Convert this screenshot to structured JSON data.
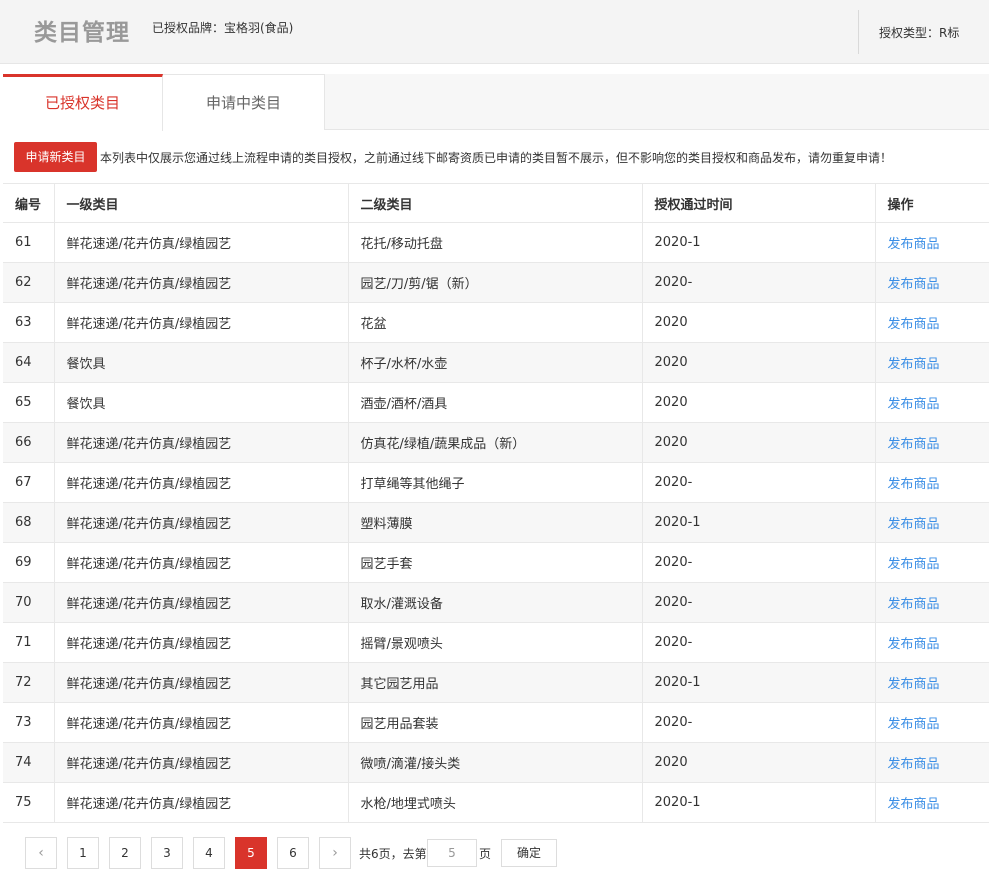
{
  "header": {
    "title": "类目管理",
    "brand": "已授权品牌：宝格羽(食品)",
    "auth_type": "授权类型：R标"
  },
  "tabs": [
    {
      "label": "已授权类目",
      "active": true
    },
    {
      "label": "申请中类目",
      "active": false
    }
  ],
  "notice": {
    "apply_button": "申请新类目",
    "message": "本列表中仅展示您通过线上流程申请的类目授权，之前通过线下邮寄资质已申请的类目暂不展示，但不影响您的类目授权和商品发布，请勿重复申请！"
  },
  "table": {
    "columns": [
      "编号",
      "一级类目",
      "二级类目",
      "授权通过时间",
      "操作"
    ],
    "rows": [
      {
        "id": "61",
        "cat1": "鲜花速递/花卉仿真/绿植园艺",
        "cat2": "花托/移动托盘",
        "time": "2020-1",
        "action": "发布商品"
      },
      {
        "id": "62",
        "cat1": "鲜花速递/花卉仿真/绿植园艺",
        "cat2": "园艺/刀/剪/锯（新）",
        "time": "2020-",
        "action": "发布商品"
      },
      {
        "id": "63",
        "cat1": "鲜花速递/花卉仿真/绿植园艺",
        "cat2": "花盆",
        "time": "2020",
        "action": "发布商品"
      },
      {
        "id": "64",
        "cat1": "餐饮具",
        "cat2": "杯子/水杯/水壶",
        "time": "2020",
        "action": "发布商品"
      },
      {
        "id": "65",
        "cat1": "餐饮具",
        "cat2": "酒壶/酒杯/酒具",
        "time": "2020",
        "action": "发布商品"
      },
      {
        "id": "66",
        "cat1": "鲜花速递/花卉仿真/绿植园艺",
        "cat2": "仿真花/绿植/蔬果成品（新）",
        "time": "2020",
        "action": "发布商品"
      },
      {
        "id": "67",
        "cat1": "鲜花速递/花卉仿真/绿植园艺",
        "cat2": "打草绳等其他绳子",
        "time": "2020-",
        "action": "发布商品"
      },
      {
        "id": "68",
        "cat1": "鲜花速递/花卉仿真/绿植园艺",
        "cat2": "塑料薄膜",
        "time": "2020-1",
        "action": "发布商品"
      },
      {
        "id": "69",
        "cat1": "鲜花速递/花卉仿真/绿植园艺",
        "cat2": "园艺手套",
        "time": "2020-",
        "action": "发布商品"
      },
      {
        "id": "70",
        "cat1": "鲜花速递/花卉仿真/绿植园艺",
        "cat2": "取水/灌溉设备",
        "time": "2020-",
        "action": "发布商品"
      },
      {
        "id": "71",
        "cat1": "鲜花速递/花卉仿真/绿植园艺",
        "cat2": "摇臂/景观喷头",
        "time": "2020-",
        "action": "发布商品"
      },
      {
        "id": "72",
        "cat1": "鲜花速递/花卉仿真/绿植园艺",
        "cat2": "其它园艺用品",
        "time": "2020-1",
        "action": "发布商品"
      },
      {
        "id": "73",
        "cat1": "鲜花速递/花卉仿真/绿植园艺",
        "cat2": "园艺用品套装",
        "time": "2020-",
        "action": "发布商品"
      },
      {
        "id": "74",
        "cat1": "鲜花速递/花卉仿真/绿植园艺",
        "cat2": "微喷/滴灌/接头类",
        "time": "2020",
        "action": "发布商品"
      },
      {
        "id": "75",
        "cat1": "鲜花速递/花卉仿真/绿植园艺",
        "cat2": "水枪/地埋式喷头",
        "time": "2020-1",
        "action": "发布商品"
      }
    ]
  },
  "pagination": {
    "prev_icon": "chevron-left-icon",
    "next_icon": "chevron-right-icon",
    "pages": [
      "1",
      "2",
      "3",
      "4",
      "5",
      "6"
    ],
    "current": "5",
    "total_text": "共6页，去第",
    "page_suffix": "页",
    "goto_value": "5",
    "confirm": "确定"
  },
  "colors": {
    "accent": "#d9342b",
    "link": "#3a8ee6"
  }
}
